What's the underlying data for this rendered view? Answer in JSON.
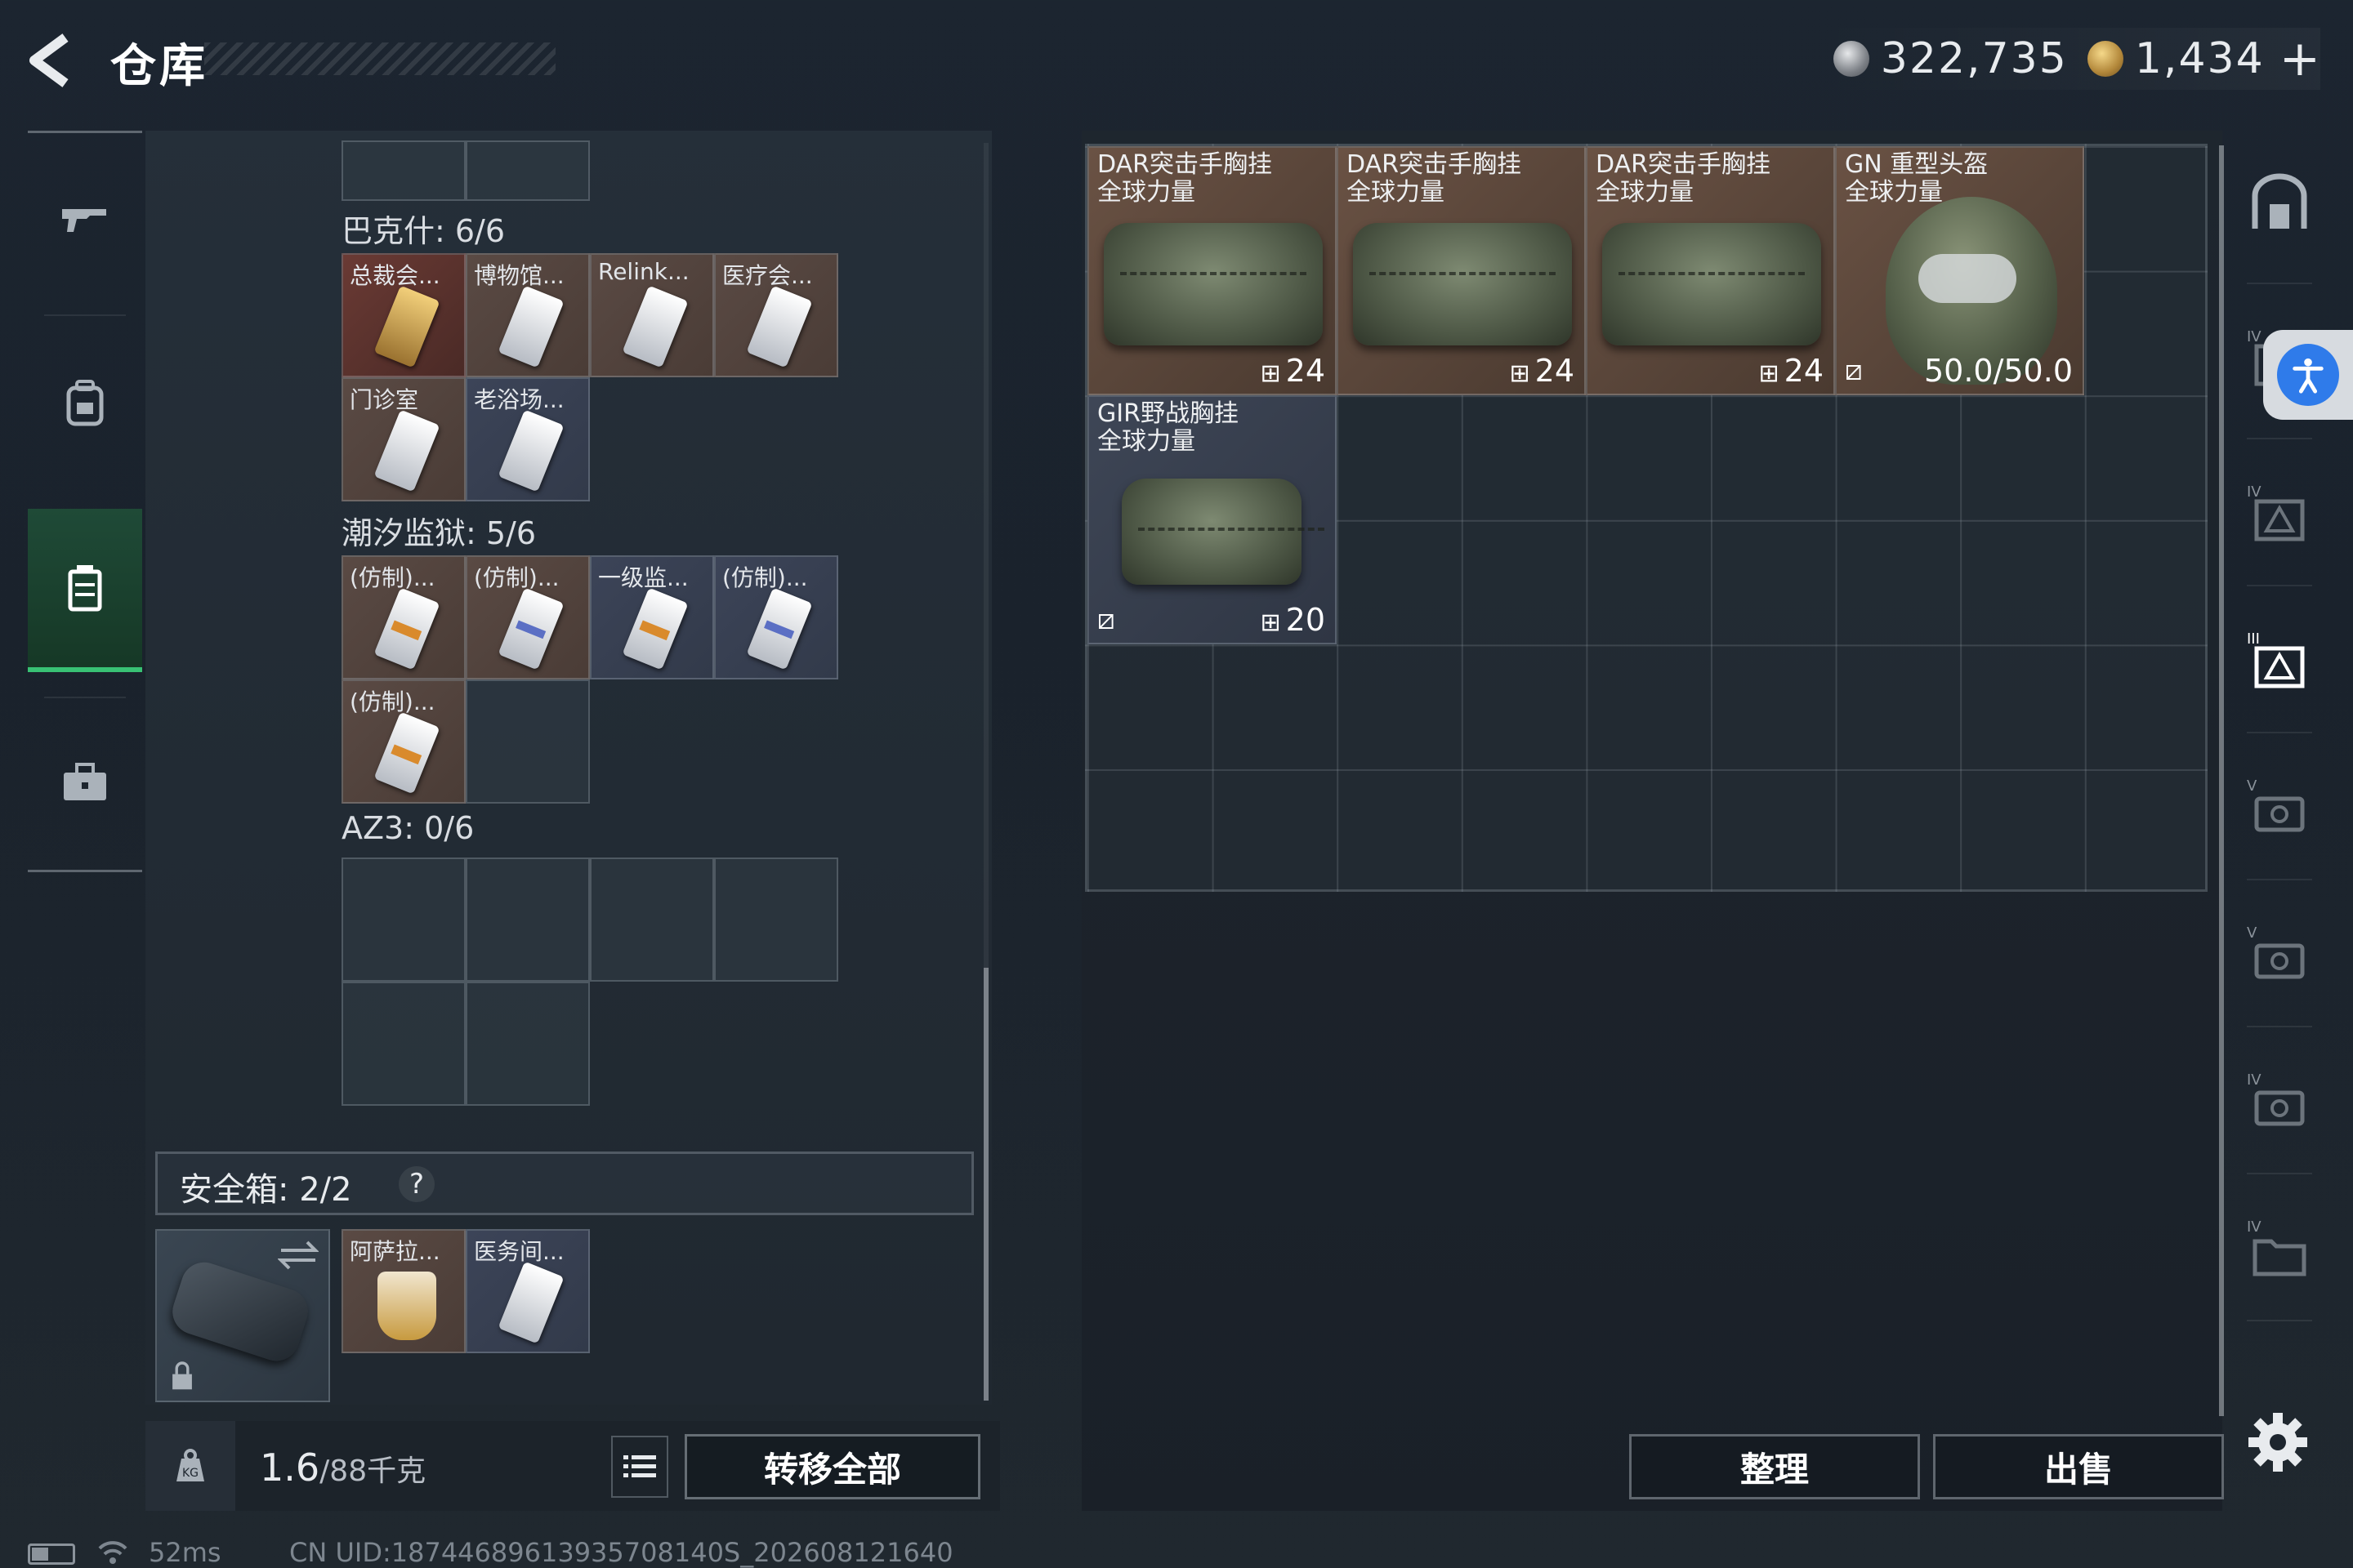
{
  "header": {
    "title": "仓库",
    "currency_silver": "322,735",
    "currency_gold": "1,434",
    "plus": "+"
  },
  "left_nav": {
    "items": [
      {
        "name": "weapons",
        "icon": "gun-icon"
      },
      {
        "name": "backpack",
        "icon": "backpack-icon"
      },
      {
        "name": "storage",
        "icon": "storage-case-icon",
        "active": true
      },
      {
        "name": "toolbox",
        "icon": "briefcase-icon"
      }
    ]
  },
  "keycards": {
    "sections": [
      {
        "label": "巴克什: 6/6",
        "items": [
          "总裁会...",
          "博物馆...",
          "Relink...",
          "医疗会...",
          "门诊室",
          "老浴场..."
        ]
      },
      {
        "label": "潮汐监狱: 5/6",
        "items": [
          "(仿制)...",
          "(仿制)...",
          "一级监...",
          "(仿制)...",
          "(仿制)..."
        ]
      },
      {
        "label": "AZ3: 0/6",
        "items": []
      }
    ]
  },
  "safe_box": {
    "label": "安全箱: 2/2",
    "help": "?",
    "items": [
      "阿萨拉...",
      "医务间..."
    ]
  },
  "footer_left": {
    "weight_value": "1.6",
    "weight_unit": "/88千克",
    "transfer_all": "转移全部"
  },
  "stash": {
    "items": [
      {
        "name": "DAR突击手胸挂",
        "sub": "全球力量",
        "count": "24"
      },
      {
        "name": "DAR突击手胸挂",
        "sub": "全球力量",
        "count": "24"
      },
      {
        "name": "DAR突击手胸挂",
        "sub": "全球力量",
        "count": "24"
      },
      {
        "name": "GN 重型头盔",
        "sub": "全球力量",
        "durability": "50.0/50.0"
      },
      {
        "name": "GIR野战胸挂",
        "sub": "全球力量",
        "count": "20"
      }
    ]
  },
  "right_col": {
    "items": [
      "door-icon",
      "tier-iv-case-icon",
      "tier-iv-case-icon",
      "tier-iii-case-icon",
      "tier-v-case-icon",
      "tier-v-case-icon",
      "tier-iv-case-icon",
      "tier-iv-folder-icon"
    ],
    "tiers": [
      "IV",
      "IV",
      "III",
      "V",
      "V",
      "IV",
      "IV"
    ]
  },
  "footer_right": {
    "sort": "整理",
    "sell": "出售"
  },
  "status_bar": {
    "ping": "52ms",
    "uid": "CN UID:18744689613935708140S_202608121640"
  },
  "colors": {
    "accent_green": "#38c174",
    "accessibility_blue": "#2f7bea"
  }
}
